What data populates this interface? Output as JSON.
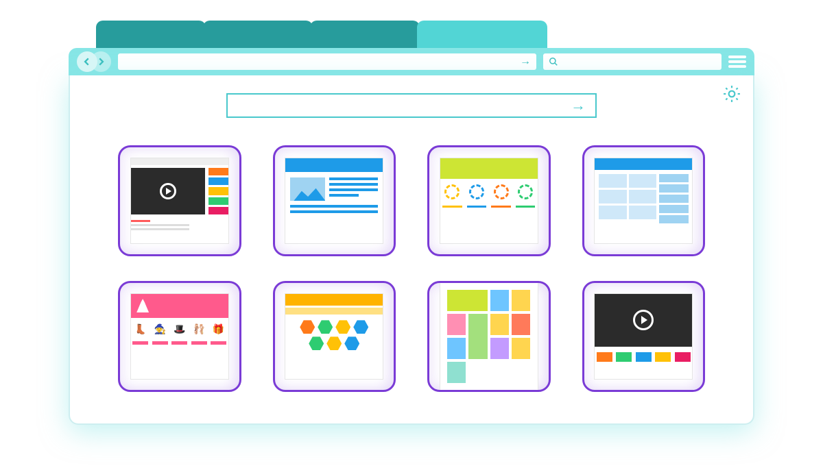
{
  "tabs": [
    {
      "active": false
    },
    {
      "active": false
    },
    {
      "active": false
    },
    {
      "active": true
    }
  ],
  "address_bar": {
    "value": "",
    "go_icon": "arrow-right"
  },
  "search_box": {
    "value": "",
    "icon": "magnifier"
  },
  "center_search": {
    "value": "",
    "go_icon": "arrow-right"
  },
  "colors": {
    "chrome": "#87e6e6",
    "tab_inactive": "#279c9c",
    "tab_active": "#52d5d5",
    "tile_border": "#7a3bd6",
    "accent_teal": "#49c8cc"
  },
  "tiles": [
    {
      "id": "video-site",
      "type": "video-portal",
      "accent_colors": [
        "#ff7a1a",
        "#1e9be8",
        "#ffc107",
        "#2ecc71",
        "#e91e63"
      ]
    },
    {
      "id": "blog",
      "type": "article-page",
      "accent": "#1e9be8"
    },
    {
      "id": "badges",
      "type": "landing-page",
      "header": "#cde534",
      "badge_colors": [
        "#ffc107",
        "#1e9be8",
        "#ff7a1a",
        "#2ecc71"
      ]
    },
    {
      "id": "dashboard",
      "type": "analytics-dashboard",
      "accent": "#1e9be8"
    },
    {
      "id": "ecommerce",
      "type": "shop",
      "accent": "#ff5a8c",
      "product_icons": [
        "boot",
        "witch-hat",
        "top-hat",
        "ballet",
        "gift"
      ]
    },
    {
      "id": "hex-badges",
      "type": "achievements",
      "accent": "#ffb300",
      "hex_count": 7
    },
    {
      "id": "gallery",
      "type": "masonry-gallery",
      "tile_colors": [
        "#cde534",
        "#6ec5ff",
        "#ffd54f",
        "#ff8fb3",
        "#a3e07d",
        "#ffd54f",
        "#ff7a5a",
        "#6ec5ff",
        "#c39bff",
        "#ffd54f",
        "#8fe0d0"
      ]
    },
    {
      "id": "video-player",
      "type": "media-player",
      "thumb_colors": [
        "#ff7a1a",
        "#2ecc71",
        "#1e9be8",
        "#ffc107",
        "#e91e63"
      ]
    }
  ]
}
